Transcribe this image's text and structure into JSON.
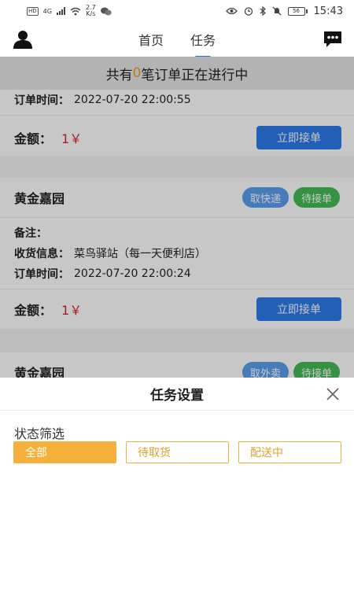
{
  "status_bar": {
    "network_label": "4G",
    "speed": "2.7",
    "speed_unit": "K/s",
    "battery": "56",
    "time": "15:43"
  },
  "header": {
    "tabs": [
      {
        "label": "首页",
        "active": false
      },
      {
        "label": "任务",
        "active": true
      }
    ]
  },
  "notice": {
    "prefix": "共有",
    "count": "0",
    "suffix": "笔订单正在进行中"
  },
  "orders": [
    {
      "order_time_label": "订单时间：",
      "order_time": "2022-07-20 22:00:55",
      "amount_label": "金额：",
      "price": "1￥",
      "accept_label": "立即接单"
    },
    {
      "title": "黄金嘉园",
      "tags": [
        "取快递",
        "待接单"
      ],
      "note_label": "备注：",
      "note": "",
      "delivery_label": "收货信息：",
      "delivery": "菜鸟驿站（每一天便利店）",
      "order_time_label": "订单时间：",
      "order_time": "2022-07-20 22:00:24",
      "amount_label": "金额：",
      "price": "1￥",
      "accept_label": "立即接单"
    },
    {
      "title": "黄金嘉园",
      "tags": [
        "取外卖",
        "待接单"
      ]
    }
  ],
  "sheet": {
    "title": "任务设置",
    "filter_label": "状态筛选",
    "filters": [
      {
        "label": "全部",
        "selected": true
      },
      {
        "label": "待取货",
        "selected": false
      },
      {
        "label": "配送中",
        "selected": false
      }
    ]
  },
  "colors": {
    "accent_blue": "#2b7ce9",
    "tag_blue": "#5b9ff0",
    "tag_green": "#45bb57",
    "price_red": "#d62828",
    "filter_orange": "#f5b13c"
  }
}
